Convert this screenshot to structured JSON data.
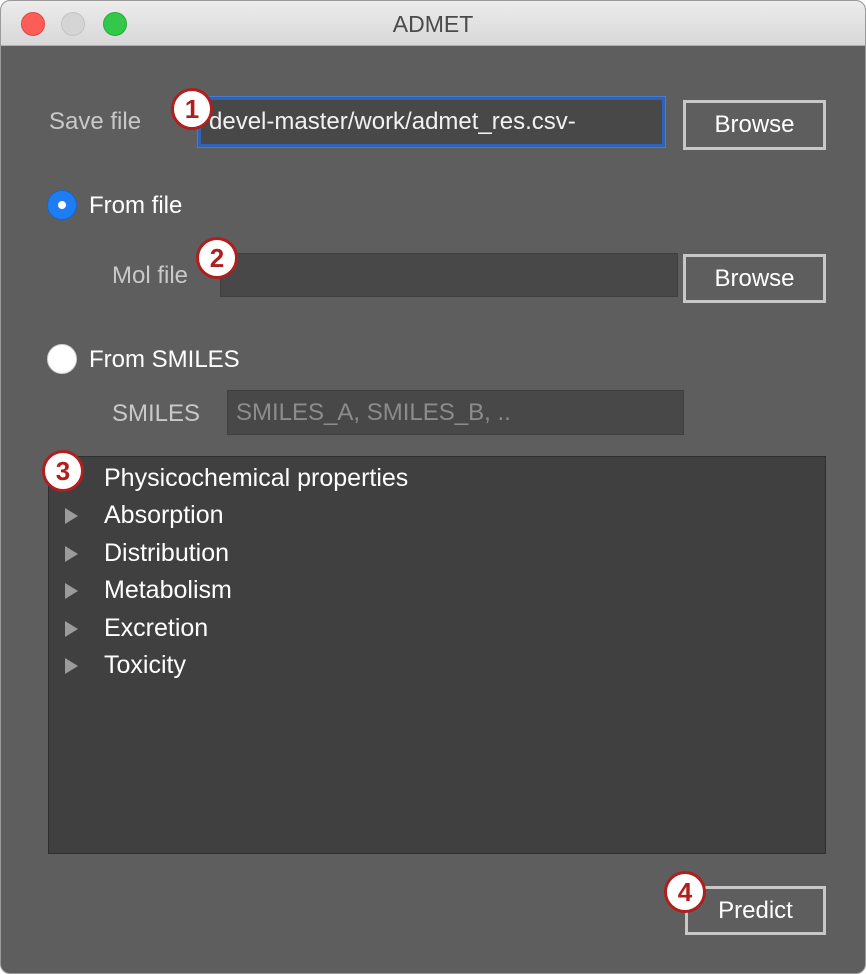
{
  "window": {
    "title": "ADMET"
  },
  "save": {
    "label": "Save file",
    "value": "-devel-master/work/admet_res.csv",
    "browse_label": "Browse"
  },
  "from_file": {
    "label": "From file",
    "selected": true
  },
  "mol": {
    "label": "Mol file",
    "value": "",
    "browse_label": "Browse"
  },
  "from_smiles": {
    "label": "From SMILES",
    "selected": false
  },
  "smiles": {
    "label": "SMILES",
    "placeholder": "SMILES_A, SMILES_B, .."
  },
  "tree": {
    "items": [
      {
        "label": "Physicochemical properties",
        "expandable": false
      },
      {
        "label": "Absorption",
        "expandable": true
      },
      {
        "label": "Distribution",
        "expandable": true
      },
      {
        "label": "Metabolism",
        "expandable": true
      },
      {
        "label": "Excretion",
        "expandable": true
      },
      {
        "label": "Toxicity",
        "expandable": true
      }
    ]
  },
  "predict": {
    "label": "Predict"
  },
  "annotations": [
    "1",
    "2",
    "3",
    "4"
  ],
  "colors": {
    "accent": "#1e7cf5",
    "focus": "#2e63b8",
    "badge": "#b01e1e",
    "window_bg": "#5e5e5e",
    "tree_bg": "#404040"
  }
}
